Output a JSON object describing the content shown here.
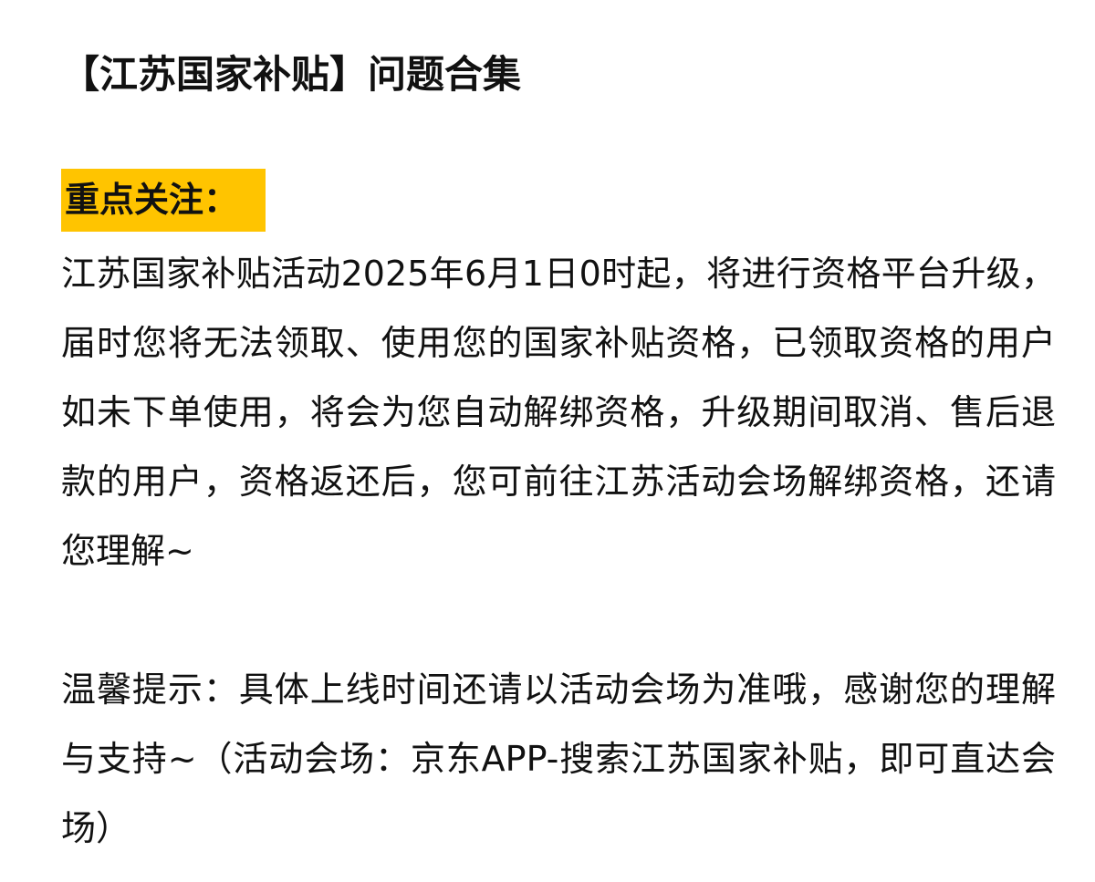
{
  "document": {
    "title": "【江苏国家补贴】问题合集",
    "highlight_heading": "重点关注：",
    "notice_paragraph": "江苏国家补贴活动2025年6月1日0时起，将进行资格平台升级，届时您将无法领取、使用您的国家补贴资格，已领取资格的用户如未下单使用，将会为您自动解绑资格，升级期间取消、售后退款的用户，资格返还后，您可前往江苏活动会场解绑资格，还请您理解~",
    "tip_paragraph": "温馨提示：具体上线时间还请以活动会场为准哦，感谢您的理解与支持~（活动会场：京东APP-搜索江苏国家补贴，即可直达会场）"
  },
  "colors": {
    "highlight_background": "#ffc400",
    "text": "#111111",
    "background": "#ffffff"
  }
}
